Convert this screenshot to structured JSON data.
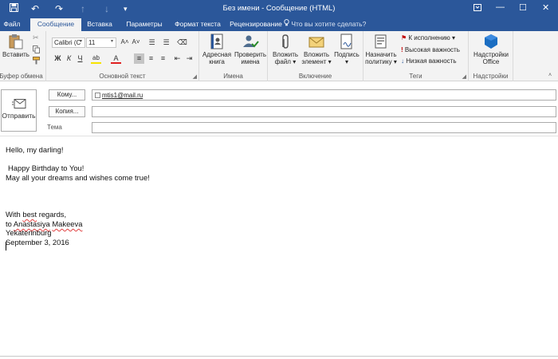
{
  "window": {
    "title": "Без имени - Сообщение (HTML)",
    "controls": {
      "options": "⬜",
      "minimize": "—",
      "maximize": "☐",
      "close": "✕"
    }
  },
  "quick_access": {
    "save": "💾",
    "undo": "↶",
    "redo": "↷",
    "up": "↑",
    "down": "↓",
    "more": "▾"
  },
  "tabs": [
    {
      "label": "Файл"
    },
    {
      "label": "Сообщение",
      "active": true
    },
    {
      "label": "Вставка"
    },
    {
      "label": "Параметры"
    },
    {
      "label": "Формат текста"
    },
    {
      "label": "Рецензирование"
    }
  ],
  "tell_me": "Что вы хотите сделать?",
  "ribbon": {
    "clipboard": {
      "paste": "Вставить",
      "group": "Буфер обмена"
    },
    "basic_text": {
      "font": "Calibri (С",
      "size": "11",
      "grow": "A˄",
      "shrink": "A˅",
      "bullets": "☰",
      "numbering": "☰",
      "clear": "⌫",
      "bold": "Ж",
      "italic": "К",
      "underline": "Ч",
      "highlight": "ab",
      "font_color": "A",
      "align_left": "≡",
      "align_center": "≡",
      "align_right": "≡",
      "decrease_indent": "⇤",
      "increase_indent": "⇥",
      "group": "Основной текст"
    },
    "names": {
      "address_book_1": "Адресная",
      "address_book_2": "книга",
      "check_names_1": "Проверить",
      "check_names_2": "имена",
      "group": "Имена"
    },
    "include": {
      "attach_file_1": "Вложить",
      "attach_file_2": "файл ▾",
      "attach_item_1": "Вложить",
      "attach_item_2": "элемент ▾",
      "signature_1": "Подпись",
      "signature_2": "▾",
      "group": "Включение"
    },
    "tags": {
      "assign_policy_1": "Назначить",
      "assign_policy_2": "политику ▾",
      "follow_up": "К исполнению ▾",
      "high_importance": "Высокая важность",
      "low_importance": "Низкая важность",
      "group": "Теги"
    },
    "addins": {
      "office_addins_1": "Надстройки",
      "office_addins_2": "Office",
      "group": "Надстройки"
    }
  },
  "header": {
    "send": "Отправить",
    "to_button": "Кому...",
    "cc_button": "Копия...",
    "subject_label": "Тема",
    "to_value": "mtis1@mail.ru",
    "cc_value": "",
    "subject_value": ""
  },
  "message": {
    "greeting": "Hello, my darling!",
    "wish_1": "Happy Birthday to You!",
    "wish_2": "May all your dreams and wishes come true!",
    "closing_1": "With ",
    "closing_2": "best",
    "closing_3": " regards,",
    "to_1": "to ",
    "to_2": "Anastasiya",
    "to_3": " ",
    "to_4": "Makeeva",
    "city": "Yekaterinburg",
    "date": "September 3, 2016"
  },
  "colors": {
    "title_bar": "#2b579a",
    "ribbon": "#f3f3f3",
    "accent_flag": "#c00000",
    "addins_icon": "#1b6ec2"
  }
}
